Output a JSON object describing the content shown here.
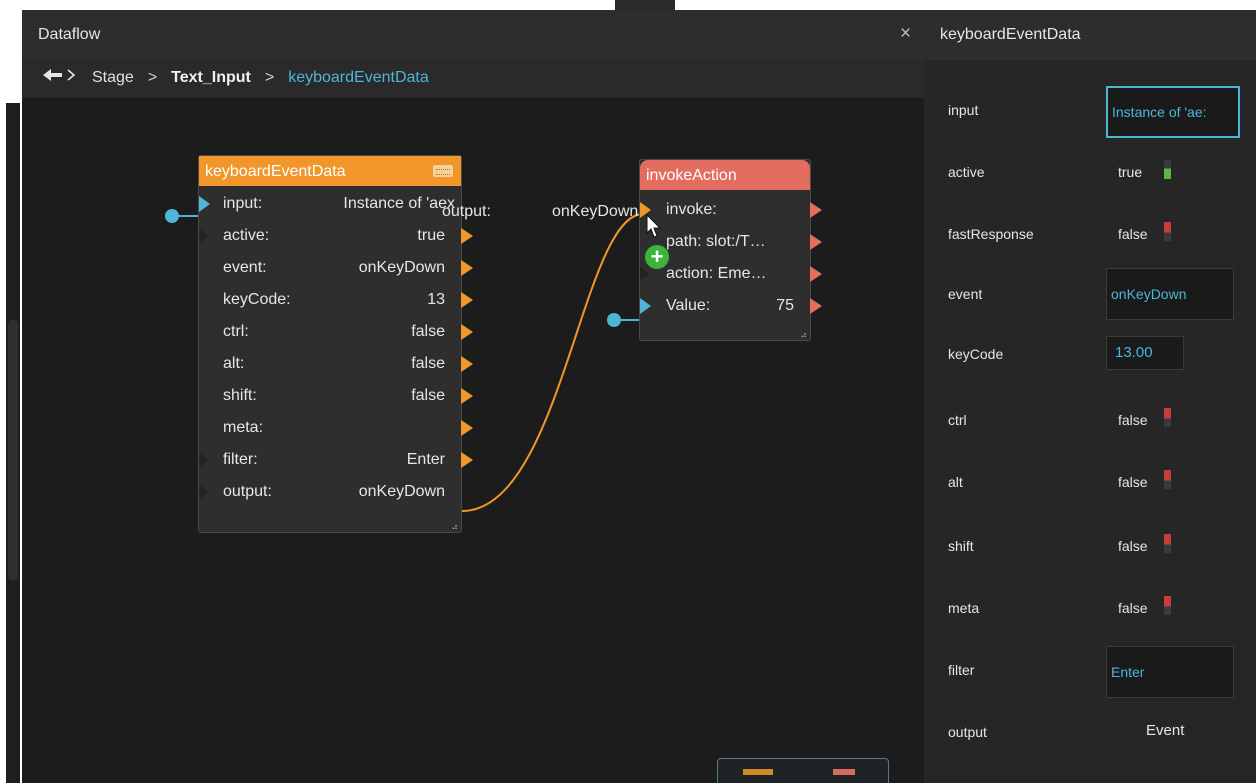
{
  "dataflow": {
    "title": "Dataflow",
    "close_icon": "×",
    "back_icon": "←",
    "breadcrumb": [
      "Stage",
      "Text_Input",
      "keyboardEventData"
    ],
    "breadcrumb_sep": ">"
  },
  "nodes": {
    "keyboard": {
      "title": "keyboardEventData",
      "icon": "keyboard-icon",
      "rows": [
        {
          "key": "input:",
          "value": "Instance of 'aex"
        },
        {
          "key": "active:",
          "value": "true"
        },
        {
          "key": "event:",
          "value": "onKeyDown"
        },
        {
          "key": "keyCode:",
          "value": "13"
        },
        {
          "key": "ctrl:",
          "value": "false"
        },
        {
          "key": "alt:",
          "value": "false"
        },
        {
          "key": "shift:",
          "value": "false"
        },
        {
          "key": "meta:",
          "value": ""
        },
        {
          "key": "filter:",
          "value": "Enter"
        },
        {
          "key": "output:",
          "value": "onKeyDown"
        }
      ]
    },
    "invoke": {
      "title": "invokeAction",
      "rows": [
        {
          "key": "invoke:",
          "value": ""
        },
        {
          "key": "path: slot:/T…",
          "value": ""
        },
        {
          "key": "action: Eme…",
          "value": ""
        },
        {
          "key": "Value:",
          "value": "75"
        }
      ]
    }
  },
  "wire_label": {
    "name": "output:",
    "value": "onKeyDown"
  },
  "inspector": {
    "title": "keyboardEventData",
    "props": [
      {
        "label": "input",
        "kind": "field",
        "value": "Instance of 'ae:"
      },
      {
        "label": "active",
        "kind": "bool",
        "value": "true"
      },
      {
        "label": "fastResponse",
        "kind": "bool",
        "value": "false"
      },
      {
        "label": "event",
        "kind": "field",
        "value": "onKeyDown"
      },
      {
        "label": "keyCode",
        "kind": "field",
        "value": "13.00"
      },
      {
        "label": "ctrl",
        "kind": "bool",
        "value": "false"
      },
      {
        "label": "alt",
        "kind": "bool",
        "value": "false"
      },
      {
        "label": "shift",
        "kind": "bool",
        "value": "false"
      },
      {
        "label": "meta",
        "kind": "bool",
        "value": "false"
      },
      {
        "label": "filter",
        "kind": "field",
        "value": "Enter"
      },
      {
        "label": "output",
        "kind": "text",
        "value": "Event"
      }
    ]
  },
  "colors": {
    "accent": "#4db6d8",
    "node_keyboard": "#f0962a",
    "node_invoke": "#e26d5f",
    "on": "#5fb544",
    "off": "#c83c3c"
  }
}
